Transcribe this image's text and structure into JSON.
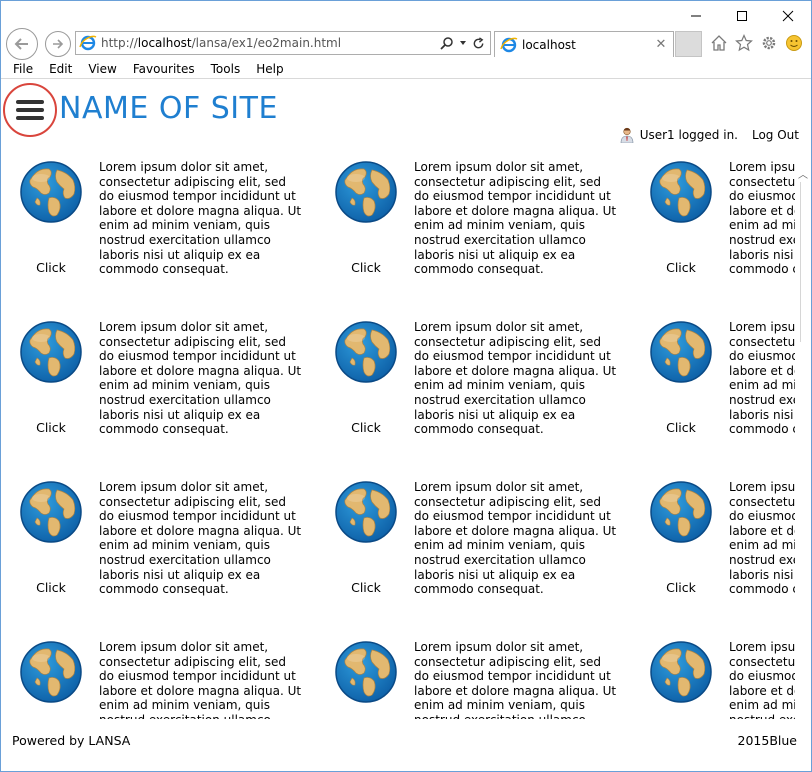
{
  "browser": {
    "address": {
      "prefix": "http://",
      "host": "localhost",
      "path": "/lansa/ex1/eo2main.html"
    },
    "tab": {
      "title": "localhost"
    }
  },
  "menu": [
    "File",
    "Edit",
    "View",
    "Favourites",
    "Tools",
    "Help"
  ],
  "header": {
    "site_name": "NAME OF SITE",
    "user_status": "User1 logged in.",
    "logout_label": "Log Out"
  },
  "cards": {
    "click_label": "Click",
    "text": "Lorem ipsum dolor sit amet, consectetur adipiscing elit, sed do eiusmod tempor incididunt ut labore et dolore magna aliqua. Ut enim ad minim veniam, quis nostrud exercitation ullamco laboris nisi ut aliquip ex ea commodo consequat.",
    "rows": 4,
    "columns": 3
  },
  "footer": {
    "powered_by": "Powered by LANSA",
    "version": "2015Blue"
  },
  "colors": {
    "site_name": "#1f7fd0",
    "hamburger_ring": "#d9453c",
    "window_border": "#6aa0d8"
  },
  "icons": {
    "back": "back-arrow-icon",
    "forward": "forward-arrow-icon",
    "home": "home-icon",
    "favorites": "star-icon",
    "settings": "gear-icon",
    "feedback": "smiley-icon",
    "menu": "hamburger-icon",
    "card": "globe-icon",
    "user": "user-icon"
  }
}
